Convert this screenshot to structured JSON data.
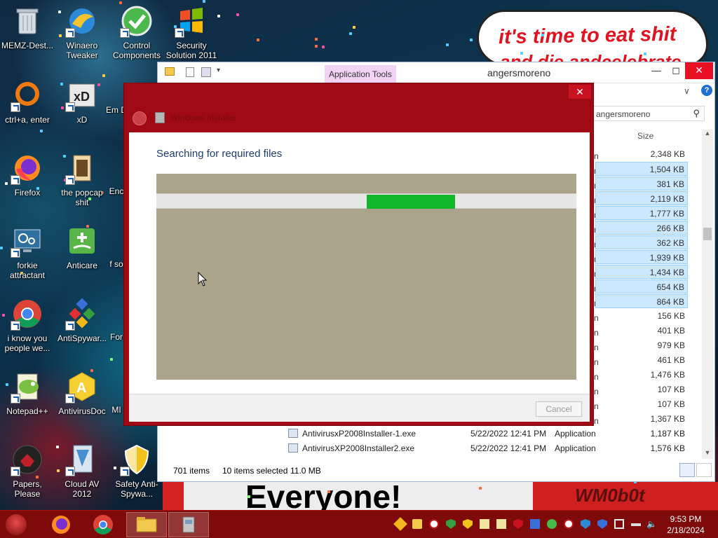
{
  "desktop": {
    "meme_text": "it's time to eat shit",
    "meme_text_2": "and die andcelebrate",
    "banner_text": "Everyone!",
    "wm_text": "WM0b0t",
    "icons": [
      {
        "label": "MEMZ-Dest..."
      },
      {
        "label": "Winaero Tweaker"
      },
      {
        "label": "Control Components"
      },
      {
        "label": "Security Solution 2011"
      },
      {
        "label": "ctrl+a, enter"
      },
      {
        "label": "xD"
      },
      {
        "label": "Em D"
      },
      {
        "label": "Firefox"
      },
      {
        "label": "the popcap shit"
      },
      {
        "label": "Enc"
      },
      {
        "label": "forkie attractant"
      },
      {
        "label": "Anticare"
      },
      {
        "label": "f so"
      },
      {
        "label": "i know you people we..."
      },
      {
        "label": "AntiSpywar..."
      },
      {
        "label": "For"
      },
      {
        "label": "Notepad++"
      },
      {
        "label": "AntivirusDoc"
      },
      {
        "label": "MI"
      },
      {
        "label": "Papers, Please"
      },
      {
        "label": "Cloud AV 2012"
      },
      {
        "label": "Safety Anti-Spywa..."
      }
    ]
  },
  "explorer": {
    "title": "angersmoreno",
    "app_tools_tab": "Application Tools",
    "search_value": "angersmoreno",
    "size_header": "Size",
    "sizes": [
      "2,348 KB",
      "1,504 KB",
      "381 KB",
      "2,119 KB",
      "1,777 KB",
      "266 KB",
      "362 KB",
      "1,939 KB",
      "1,434 KB",
      "654 KB",
      "864 KB",
      "156 KB",
      "401 KB",
      "979 KB",
      "461 KB",
      "1,476 KB",
      "107 KB",
      "107 KB",
      "1,367 KB"
    ],
    "files": [
      {
        "name": "AntivirusxP2008Installer-1.exe",
        "date": "5/22/2022 12:41 PM",
        "type": "Application",
        "size": "1,187 KB"
      },
      {
        "name": "AntivirusXP2008Installer2.exe",
        "date": "5/22/2022 12:41 PM",
        "type": "Application",
        "size": "1,576 KB"
      }
    ],
    "status_items": "701 items",
    "status_selected": "10 items selected",
    "status_size": "11.0 MB"
  },
  "installer": {
    "title": "Windows Installer",
    "heading": "Searching for required files",
    "progress": 0.21,
    "progress_start": 0.5,
    "cancel_label": "Cancel"
  },
  "taskbar": {
    "time": "9:53 PM",
    "date": "2/18/2024"
  },
  "colors": {
    "installer_frame": "#9f0a14",
    "progress_fill": "#10b52a",
    "taskbar": "#7e0a0a",
    "selection": "#cce8ff"
  }
}
